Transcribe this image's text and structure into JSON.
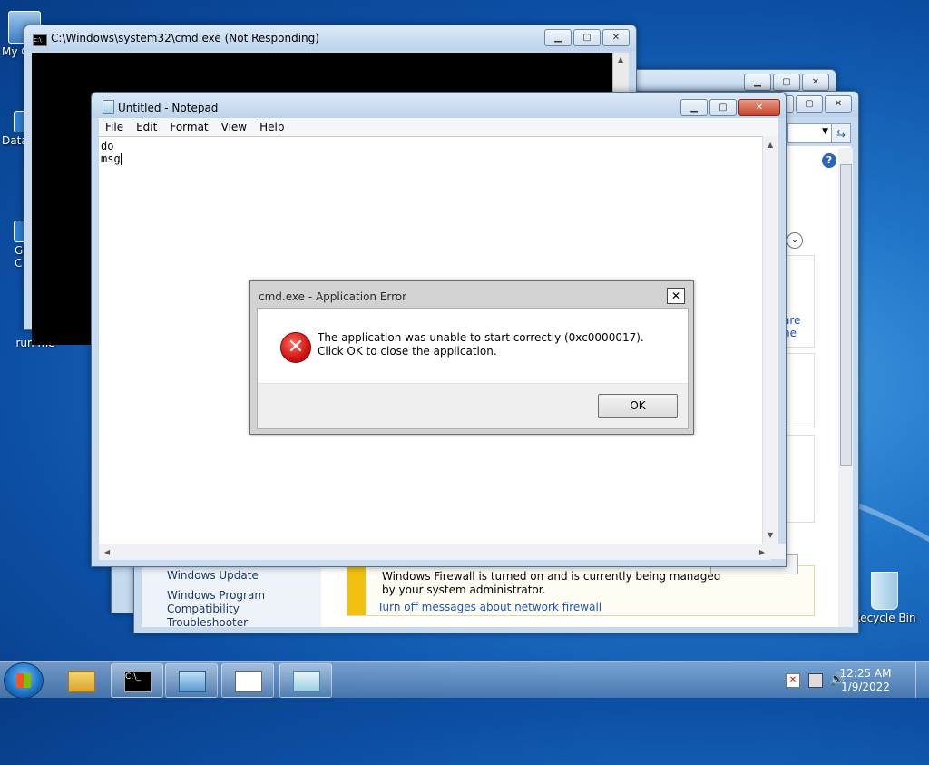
{
  "desktop": {
    "icons": [
      {
        "label": "My C"
      },
      {
        "label": "Data"
      },
      {
        "label": "G\nC"
      },
      {
        "label": "run me"
      },
      {
        "label": "Recycle Bin"
      }
    ]
  },
  "cmd_window": {
    "title": "C:\\Windows\\system32\\cmd.exe (Not Responding)"
  },
  "control_panel": {
    "sidebar_links": [
      "Windows Update",
      "Windows Program Compatibility Troubleshooter"
    ],
    "firewall_message": "Windows Firewall is turned on and is currently being managed by your system administrator.",
    "firewall_link": "Turn off messages about network firewall",
    "partial_link_1": "are",
    "partial_link_2": "ne"
  },
  "notepad": {
    "title": "Untitled - Notepad",
    "menu": [
      "File",
      "Edit",
      "Format",
      "View",
      "Help"
    ],
    "lines": [
      "do",
      "msg"
    ]
  },
  "dialog": {
    "title": "cmd.exe - Application Error",
    "message": "The application was unable to start correctly (0xc0000017). Click OK to close the application.",
    "ok_label": "OK"
  },
  "taskbar": {
    "time": "12:25 AM",
    "date": "1/9/2022"
  },
  "colors": {
    "desktop": "#1f74c8",
    "error_red": "#d31313",
    "link": "#1a56b8",
    "firewall_yellow": "#f2c010"
  }
}
